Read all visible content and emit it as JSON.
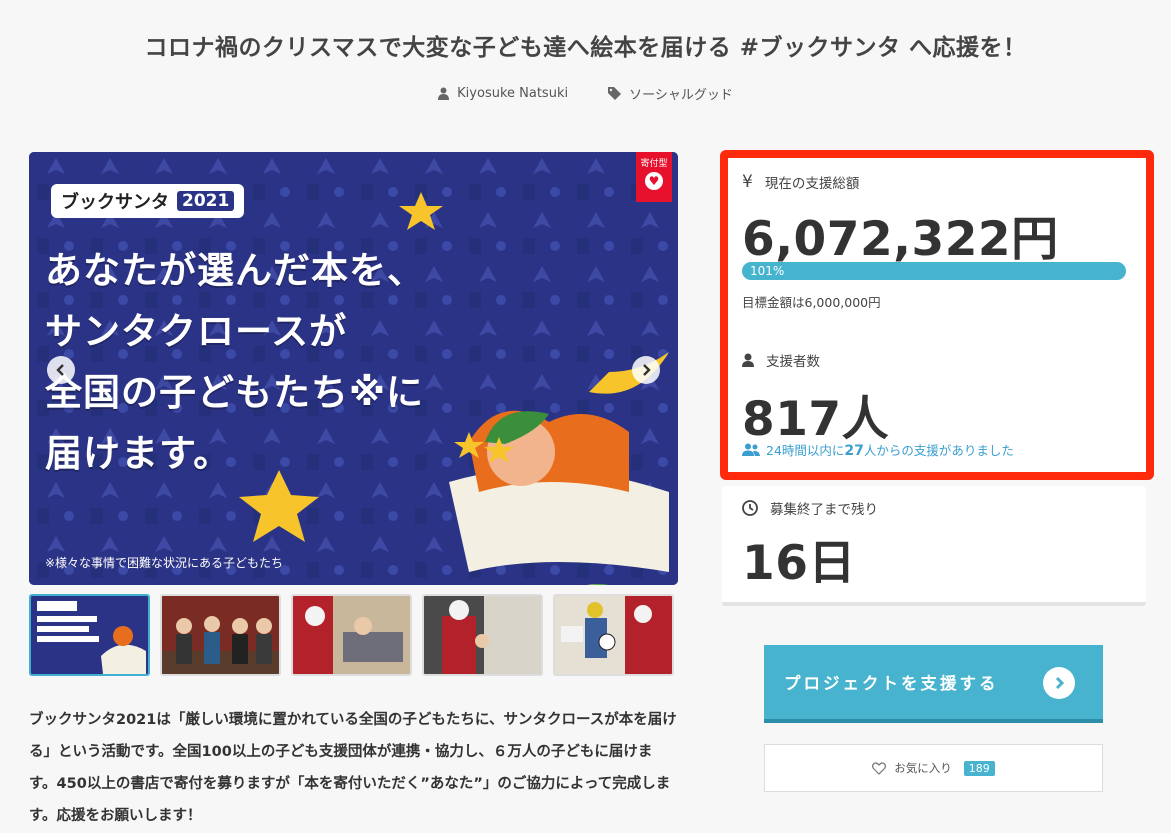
{
  "page": {
    "title": "コロナ禍のクリスマスで大変な子ども達へ絵本を届ける #ブックサンタ へ応援を！",
    "author": "Kiyosuke Natsuki",
    "category": "ソーシャルグッド"
  },
  "hero": {
    "badge": "寄付型",
    "logo_text": "ブックサンタ",
    "logo_year": "2021",
    "lines": [
      "あなたが選んだ本を、",
      "サンタクロースが",
      "全国の子どもたち※に",
      "届けます。"
    ],
    "note": "※様々な事情で困難な状況にある子どもたち"
  },
  "thumbnails": [
    "thumb-1",
    "thumb-2",
    "thumb-3",
    "thumb-4",
    "thumb-5"
  ],
  "description": "ブックサンタ2021は「厳しい環境に置かれている全国の子どもたちに、サンタクロースが本を届ける」という活動です。全国100以上の子ども支援団体が連携・協力し、６万人の子どもに届けます。450以上の書店で寄付を募りますが「本を寄付いただく”あなた”」のご協力によって完成します。応援をお願いします！",
  "funding": {
    "total_label": "現在の支援総額",
    "total_value": "6,072,322円",
    "progress_label": "101%",
    "progress_fraction": 1.01,
    "goal_text": "目標金額は6,000,000円",
    "supporters_label": "支援者数",
    "supporters_value": "817人",
    "recent_prefix": "24時間以内に",
    "recent_count": "27",
    "recent_suffix": "人からの支援がありました",
    "remaining_label": "募集終了まで残り",
    "remaining_value": "16日"
  },
  "actions": {
    "support_label": "プロジェクトを支援する",
    "favorite_label": "お気に入り",
    "favorite_count": "189"
  },
  "colors": {
    "accent": "#47b3cf",
    "highlight_border": "#ff2a0c",
    "badge_red": "#e8112d",
    "hero_bg": "#2b3386"
  }
}
